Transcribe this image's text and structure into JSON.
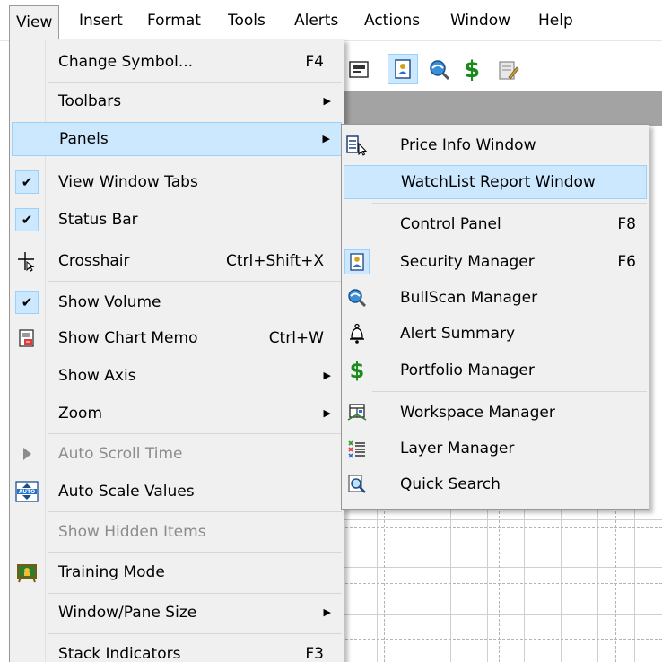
{
  "menubar": {
    "items": [
      {
        "label": "View"
      },
      {
        "label": "Insert"
      },
      {
        "label": "Format"
      },
      {
        "label": "Tools"
      },
      {
        "label": "Alerts"
      },
      {
        "label": "Actions"
      },
      {
        "label": "Window"
      },
      {
        "label": "Help"
      }
    ]
  },
  "view_menu": {
    "items": [
      {
        "label": "Change Symbol...",
        "shortcut": "F4"
      },
      {
        "label": "Toolbars"
      },
      {
        "label": "Panels"
      },
      {
        "label": "View Window Tabs",
        "icon": "check-icon"
      },
      {
        "label": "Status Bar",
        "icon": "check-icon"
      },
      {
        "label": "Crosshair",
        "shortcut": "Ctrl+Shift+X",
        "icon": "crosshair-icon"
      },
      {
        "label": "Show Volume",
        "icon": "check-icon"
      },
      {
        "label": "Show Chart Memo",
        "shortcut": "Ctrl+W",
        "icon": "memo-icon"
      },
      {
        "label": "Show Axis"
      },
      {
        "label": "Zoom"
      },
      {
        "label": "Auto Scroll Time",
        "icon": "play-icon"
      },
      {
        "label": "Auto Scale Values",
        "icon": "auto-scale-icon"
      },
      {
        "label": "Show Hidden Items"
      },
      {
        "label": "Training Mode",
        "icon": "training-icon"
      },
      {
        "label": "Window/Pane Size"
      },
      {
        "label": "Stack Indicators",
        "shortcut": "F3"
      }
    ]
  },
  "panels_submenu": {
    "items": [
      {
        "label": "Price Info Window",
        "icon": "price-info-icon"
      },
      {
        "label": "WatchList Report Window"
      },
      {
        "label": "Control Panel",
        "shortcut": "F8"
      },
      {
        "label": "Security Manager",
        "shortcut": "F6",
        "icon": "security-manager-icon"
      },
      {
        "label": "BullScan Manager",
        "icon": "bullscan-icon"
      },
      {
        "label": "Alert Summary",
        "icon": "bell-icon"
      },
      {
        "label": "Portfolio Manager",
        "icon": "dollar-icon"
      },
      {
        "label": "Workspace Manager",
        "icon": "workspace-icon"
      },
      {
        "label": "Layer Manager",
        "icon": "layers-icon"
      },
      {
        "label": "Quick Search",
        "icon": "quick-search-icon"
      }
    ]
  },
  "toolbar": {
    "dollar_glyph": "$"
  },
  "colors": {
    "highlight": "#cce8ff",
    "highlight_border": "#99d1ff",
    "menu_bg": "#f0f0f0",
    "dollar_green": "#1a8a1a"
  }
}
